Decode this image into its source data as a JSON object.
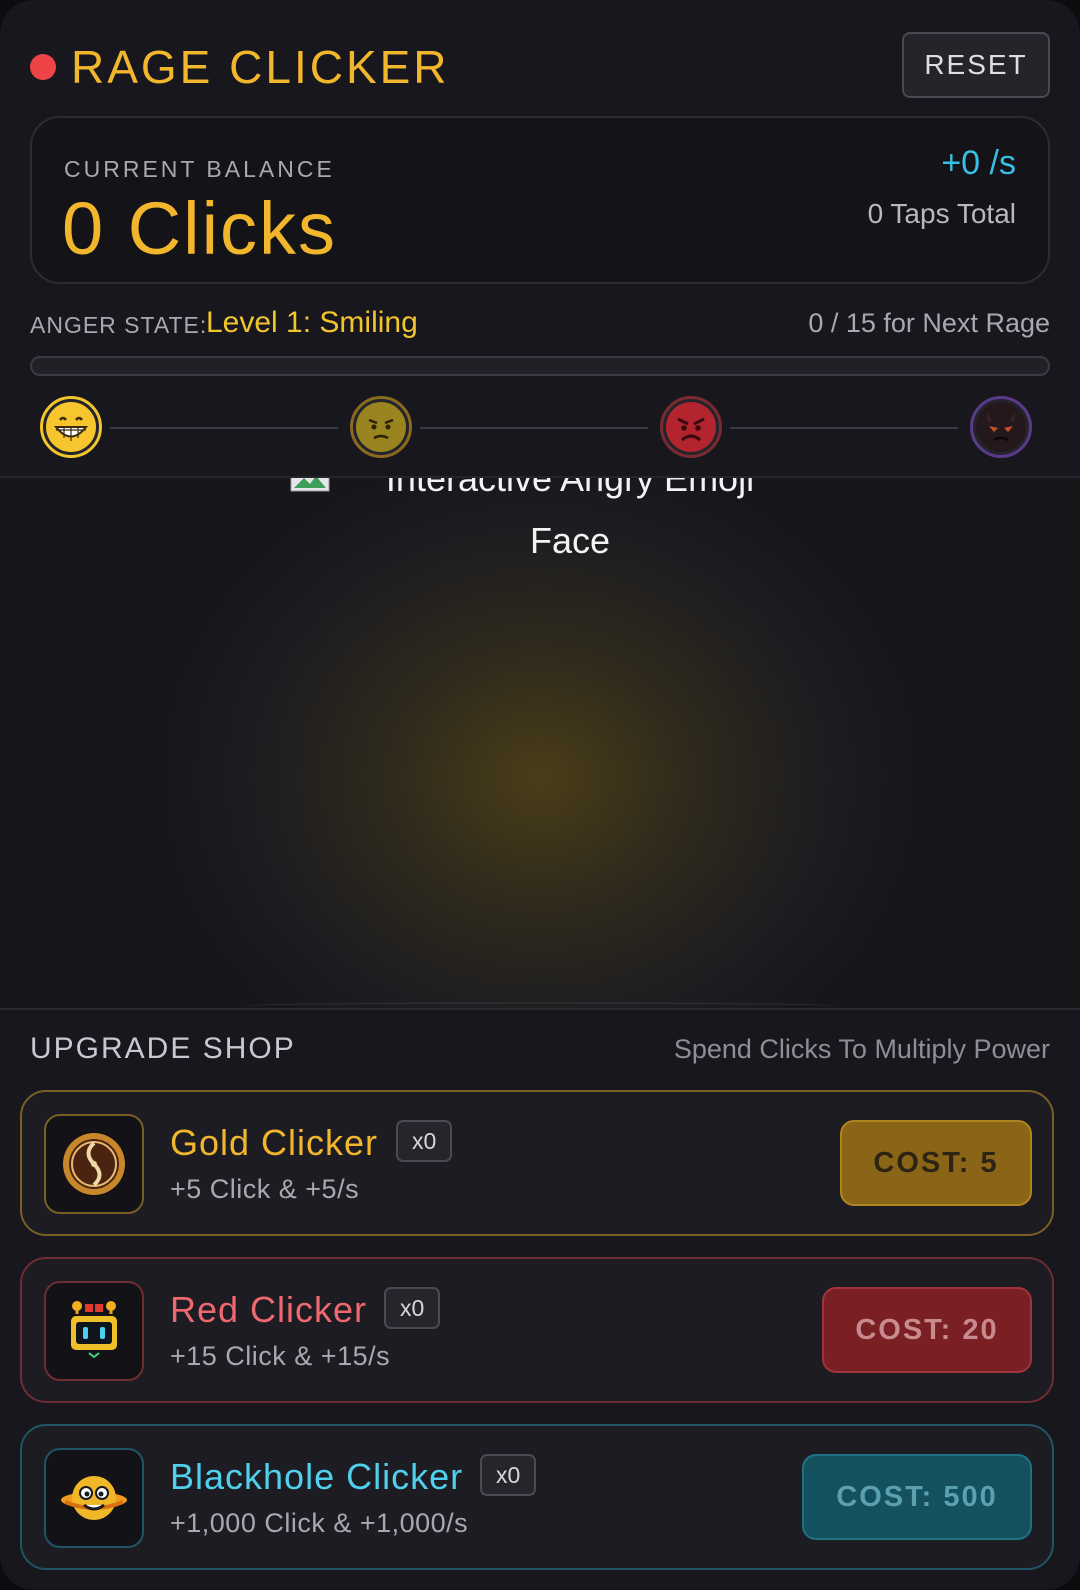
{
  "header": {
    "title": "RAGE CLICKER",
    "reset_label": "RESET"
  },
  "balance": {
    "label": "CURRENT BALANCE",
    "value": "0 Clicks",
    "rate": "+0 /s",
    "taps": "0 Taps Total"
  },
  "anger": {
    "label": "ANGER STATE:",
    "value": "Level 1: Smiling",
    "next": "0 / 15 for Next Rage",
    "progress": 0
  },
  "stages": [
    {
      "name": "smiling",
      "icon": "grinning-face-icon",
      "ring": "#f2c42e"
    },
    {
      "name": "annoyed",
      "icon": "annoyed-face-icon",
      "ring": "#8a6a1e"
    },
    {
      "name": "angry",
      "icon": "angry-face-icon",
      "ring": "#7a2a30"
    },
    {
      "name": "demon",
      "icon": "demon-face-icon",
      "ring": "#5a3a8a"
    }
  ],
  "arena": {
    "emoji_alt": "Interactive Angry Emoji Face",
    "broken_image_icon": "broken-image-icon"
  },
  "shop": {
    "title": "UPGRADE SHOP",
    "subtitle": "Spend Clicks To Multiply Power",
    "items": [
      {
        "name": "Gold Clicker",
        "count": "x0",
        "desc": "+5 Click & +5/s",
        "cost": "COST: 5",
        "icon": "gold-coin-icon",
        "color": "#f2b62c"
      },
      {
        "name": "Red Clicker",
        "count": "x0",
        "desc": "+15 Click & +15/s",
        "cost": "COST: 20",
        "icon": "robot-icon",
        "color": "#ee6870"
      },
      {
        "name": "Blackhole Clicker",
        "count": "x0",
        "desc": "+1,000 Click & +1,000/s",
        "cost": "COST: 500",
        "icon": "planet-face-icon",
        "color": "#4fd0ec"
      }
    ]
  }
}
